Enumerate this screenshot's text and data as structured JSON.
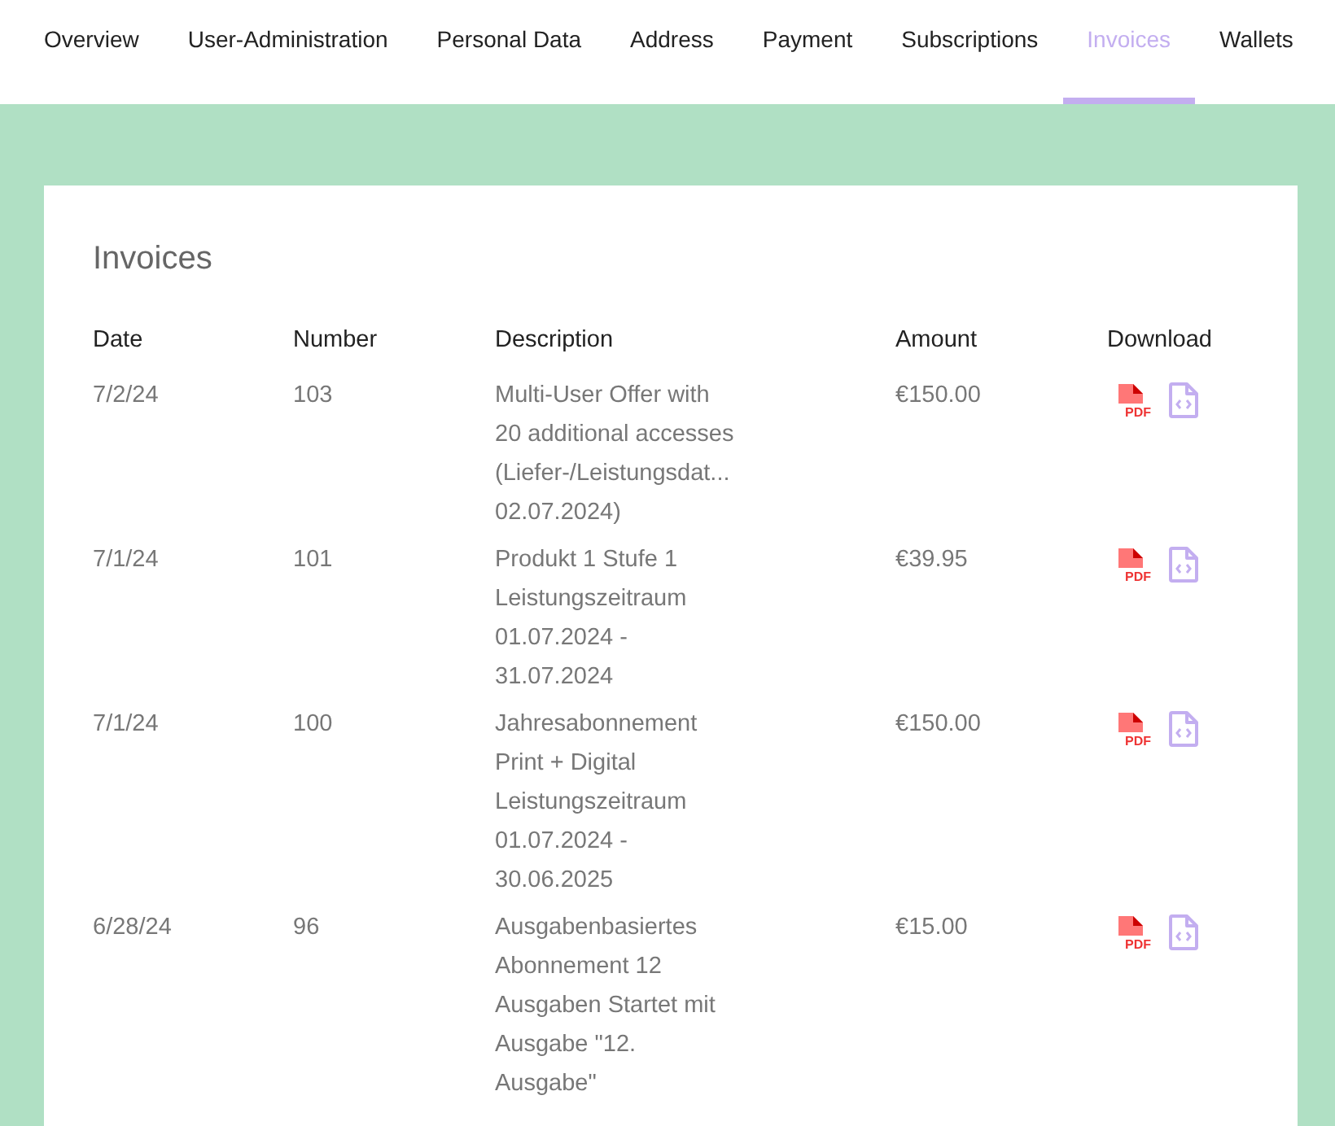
{
  "tabs": [
    {
      "label": "Overview",
      "selected": false
    },
    {
      "label": "User-Administration",
      "selected": false
    },
    {
      "label": "Personal Data",
      "selected": false
    },
    {
      "label": "Address",
      "selected": false
    },
    {
      "label": "Payment",
      "selected": false
    },
    {
      "label": "Subscriptions",
      "selected": false
    },
    {
      "label": "Invoices",
      "selected": true
    },
    {
      "label": "Wallets",
      "selected": false
    }
  ],
  "card": {
    "title": "Invoices",
    "columns": [
      "Date",
      "Number",
      "Description",
      "Amount",
      "Download"
    ],
    "rows": [
      {
        "date": "7/2/24",
        "number": "103",
        "description": [
          "Multi-User Offer with",
          "20 additional accesses",
          "(Liefer-/Leistungsdat...",
          "02.07.2024)"
        ],
        "amount": "€150.00",
        "pdf_label": "PDF"
      },
      {
        "date": "7/1/24",
        "number": "101",
        "description": [
          "Produkt 1 Stufe 1",
          "Leistungszeitraum",
          "01.07.2024 -",
          "31.07.2024"
        ],
        "amount": "€39.95",
        "pdf_label": "PDF"
      },
      {
        "date": "7/1/24",
        "number": "100",
        "description": [
          "Jahresabonnement",
          "Print + Digital",
          "Leistungszeitraum",
          "01.07.2024 -",
          "30.06.2025"
        ],
        "amount": "€150.00",
        "pdf_label": "PDF"
      },
      {
        "date": "6/28/24",
        "number": "96",
        "description": [
          "Ausgabenbasiertes",
          "Abonnement 12",
          "Ausgaben Startet mit",
          "Ausgabe \"12.",
          "Ausgabe\""
        ],
        "amount": "€15.00",
        "pdf_label": "PDF"
      }
    ]
  }
}
